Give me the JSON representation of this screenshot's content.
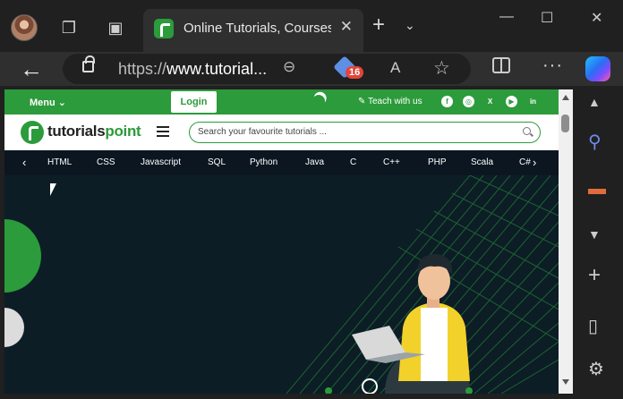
{
  "browser": {
    "tab_title": "Online Tutorials, Courses",
    "url_scheme": "https://",
    "url_domain": "www.tutorial...",
    "extension_badge": "16",
    "more_label": "···"
  },
  "site": {
    "menu_label": "Menu",
    "login_label": "Login",
    "teach_label": "Teach with us",
    "logo_main": "tutorials",
    "logo_accent": "point",
    "search_placeholder": "Search your favourite tutorials ...",
    "categories": [
      "HTML",
      "CSS",
      "Javascript",
      "SQL",
      "Python",
      "Java",
      "C",
      "C++",
      "PHP",
      "Scala",
      "C#"
    ],
    "social": [
      "f",
      "◎",
      "X",
      "▶",
      "in"
    ]
  },
  "colors": {
    "brand": "#2c9b3b",
    "hero_bg": "#0c1d26",
    "browser_bg": "#202020"
  }
}
